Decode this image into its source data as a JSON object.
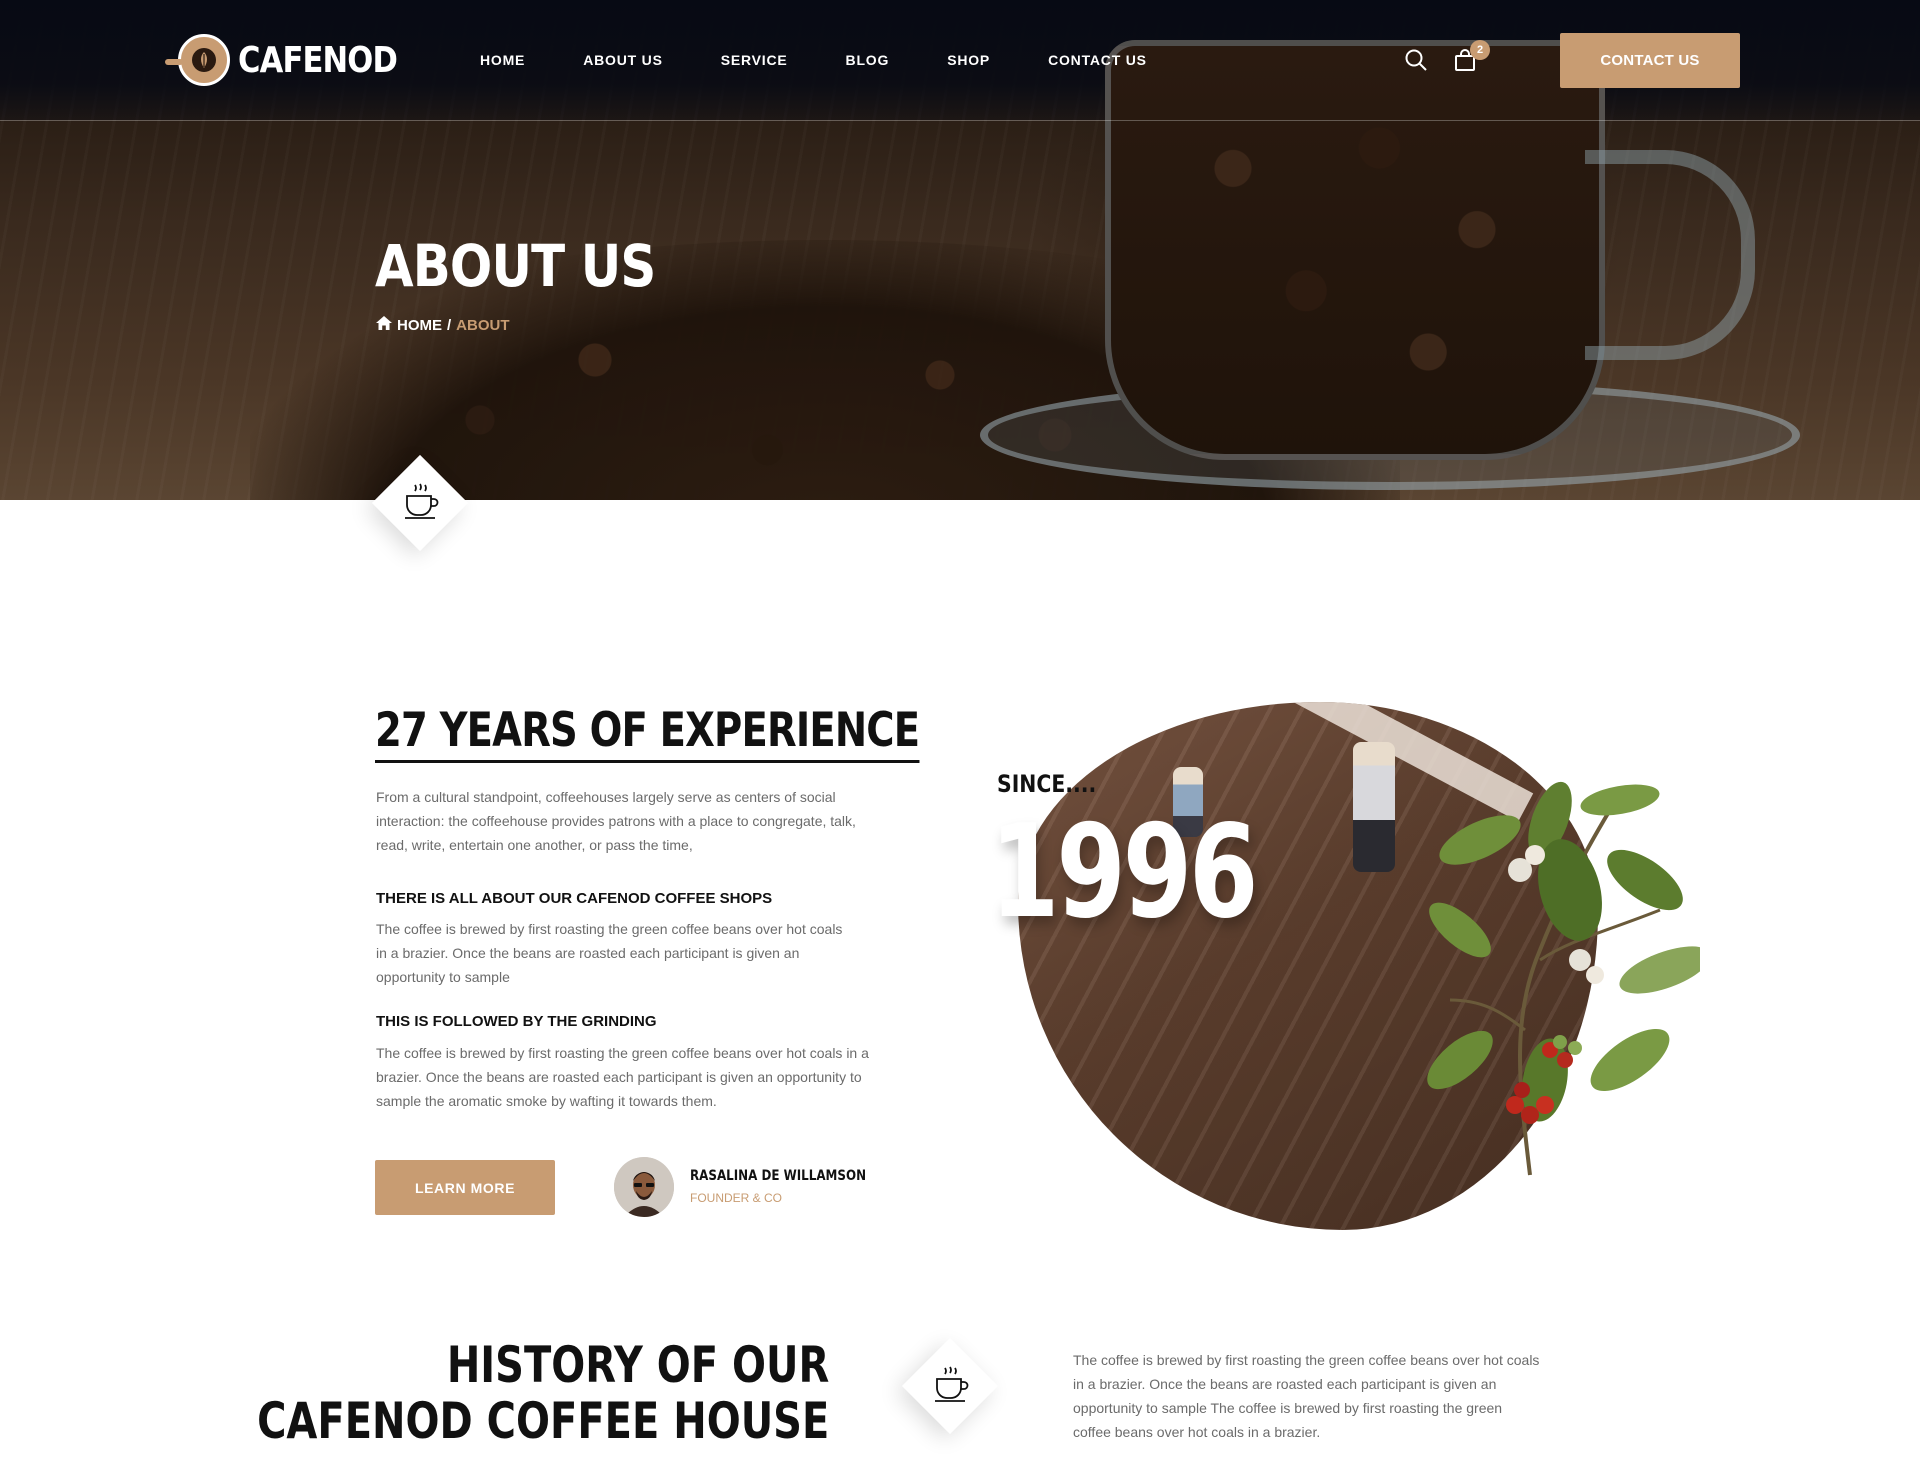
{
  "header": {
    "logo_text": "CAFENOD",
    "nav": [
      "HOME",
      "ABOUT US",
      "SERVICE",
      "BLOG",
      "SHOP",
      "CONTACT US"
    ],
    "cart_count": "2",
    "contact_button": "CONTACT US",
    "icons": {
      "search": "search-icon",
      "cart": "shopping-bag-icon"
    }
  },
  "hero": {
    "title": "ABOUT US",
    "breadcrumb": {
      "home": "HOME",
      "separator": "/",
      "current": "ABOUT"
    },
    "diamond_icon": "coffee-cup-icon"
  },
  "experience": {
    "title": "27 YEARS OF EXPERIENCE",
    "intro": "From a cultural standpoint, coffeehouses largely serve as centers of social interaction: the coffeehouse provides patrons with a place to congregate, talk, read, write, entertain one another, or pass the time,",
    "sections": [
      {
        "heading": "THERE IS ALL ABOUT OUR CAFENOD COFFEE SHOPS",
        "text": "The coffee is brewed by first roasting the green coffee beans over hot coals in a brazier. Once the beans are roasted each participant is given an opportunity to sample"
      },
      {
        "heading": "THIS IS FOLLOWED BY THE GRINDING",
        "text": "The coffee is brewed by first roasting the green coffee beans over hot coals in a brazier. Once the beans are roasted each participant is given an opportunity to sample the aromatic smoke by wafting it towards them."
      }
    ],
    "learn_more": "LEARN MORE",
    "founder": {
      "name": "RASALINA DE WILLAMSON",
      "role": "FOUNDER & CO"
    },
    "since_label": "SINCE....",
    "year": "1996"
  },
  "history": {
    "title_line1": "HISTORY OF OUR",
    "title_line2": "CAFENOD COFFEE HOUSE",
    "text": "The coffee is brewed by first roasting the green coffee beans over hot coals in a brazier. Once the beans are roasted each participant is given an opportunity to sample The coffee is brewed by first roasting the green coffee beans over hot coals in a brazier.",
    "diamond_icon": "coffee-cup-icon"
  },
  "colors": {
    "accent": "#c89c72",
    "header_bg": "#070a14",
    "heading": "#111111",
    "body_text": "#6b6b6b"
  }
}
